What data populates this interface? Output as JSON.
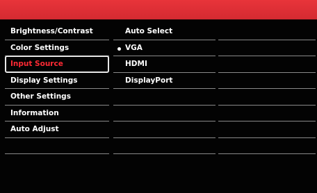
{
  "main_menu": [
    {
      "label": "Brightness/Contrast"
    },
    {
      "label": "Color Settings"
    },
    {
      "label": "Input Source",
      "selected": true
    },
    {
      "label": "Display Settings"
    },
    {
      "label": "Other Settings"
    },
    {
      "label": "Information"
    },
    {
      "label": "Auto Adjust"
    },
    {
      "label": ""
    }
  ],
  "submenu": [
    {
      "label": "Auto Select"
    },
    {
      "label": "VGA",
      "active": true
    },
    {
      "label": "HDMI"
    },
    {
      "label": "DisplayPort"
    },
    {
      "label": ""
    },
    {
      "label": ""
    },
    {
      "label": ""
    },
    {
      "label": ""
    }
  ],
  "colors": {
    "header": "#e8343a",
    "selected_text": "#ff2a34",
    "background": "#030303"
  },
  "icons": {
    "active_marker": "bullet-dot-icon"
  }
}
